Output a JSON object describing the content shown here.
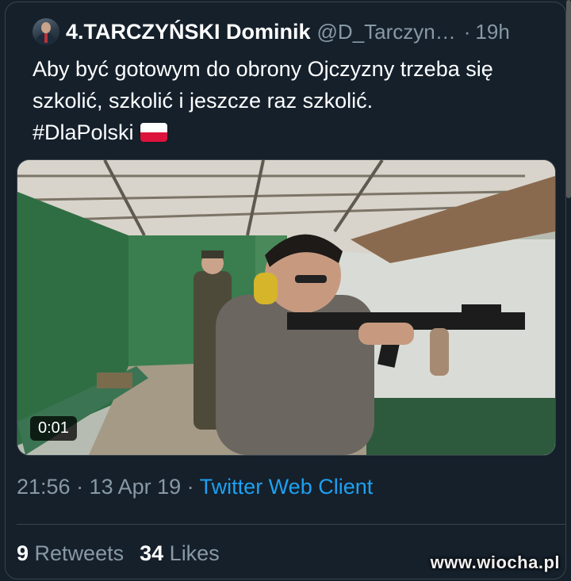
{
  "tweet": {
    "display_name": "4.TARCZYŃSKI Dominik",
    "handle": "@D_Tarczyn…",
    "separator": "·",
    "relative_time": "19h",
    "text_lines": [
      "Aby być gotowym do obrony Ojczyzny trzeba się",
      "szkolić, szkolić i jeszcze raz szkolić.",
      "#DlaPolski"
    ],
    "flag_icon": "poland-flag-icon",
    "media": {
      "type": "video",
      "duration": "0:01"
    },
    "timestamp": "21:56 · 13 Apr 19 ·",
    "client": "Twitter Web Client",
    "retweets_count": "9",
    "retweets_label": "Retweets",
    "likes_count": "34",
    "likes_label": "Likes"
  },
  "watermark": "www.wiocha.pl",
  "colors": {
    "background": "#15202b",
    "secondary_text": "#8899a6",
    "link": "#1da1f2",
    "border": "#38444d"
  }
}
